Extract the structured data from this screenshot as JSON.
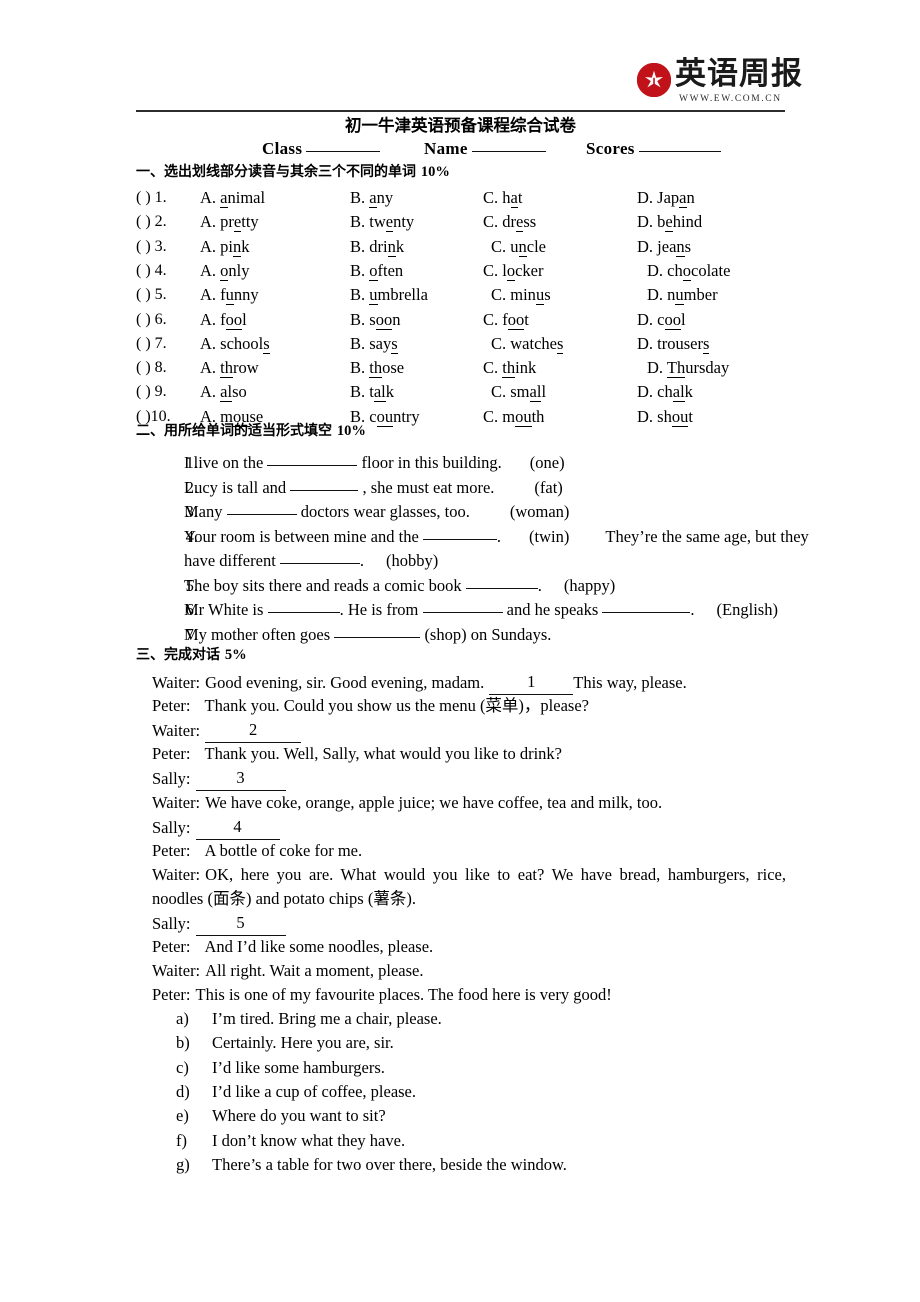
{
  "logo": {
    "name_cn": "英语周报",
    "url": "WWW.EW.COM.CN",
    "mark_color": "#c1121a"
  },
  "header": {
    "title": "初一牛津英语预备课程综合试卷",
    "fields": [
      {
        "label": "Class",
        "value": ""
      },
      {
        "label": "Name",
        "value": ""
      },
      {
        "label": "Scores",
        "value": ""
      }
    ]
  },
  "section1": {
    "heading": "一、选出划线部分读音与其余三个不同的单词",
    "points": "10%",
    "rows": [
      {
        "num": "(  ) 1.",
        "a": [
          "",
          "a",
          "nimal"
        ],
        "b": [
          "",
          "a",
          "ny"
        ],
        "c": [
          "h",
          "a",
          "t"
        ],
        "d": [
          "Jap",
          "a",
          "n"
        ]
      },
      {
        "num": "(  ) 2.",
        "a": [
          "pr",
          "e",
          "tty"
        ],
        "b": [
          "tw",
          "e",
          "nty"
        ],
        "c": [
          "dr",
          "e",
          "ss"
        ],
        "d": [
          "b",
          "e",
          "hind"
        ]
      },
      {
        "num": "(  ) 3.",
        "a": [
          "pi",
          "n",
          "k"
        ],
        "b": [
          "dri",
          "n",
          "k"
        ],
        "c": [
          "u",
          "n",
          "cle"
        ],
        "d": [
          "jea",
          "n",
          "s"
        ]
      },
      {
        "num": "(  ) 4.",
        "a": [
          "",
          "o",
          "nly"
        ],
        "b": [
          "",
          "o",
          "ften"
        ],
        "c": [
          "l",
          "o",
          "cker"
        ],
        "d": [
          "ch",
          "o",
          "colate"
        ]
      },
      {
        "num": "(  ) 5.",
        "a": [
          "f",
          "u",
          "nny"
        ],
        "b": [
          "",
          "u",
          "mbrella"
        ],
        "c": [
          "min",
          "u",
          "s"
        ],
        "d": [
          "n",
          "u",
          "mber"
        ]
      },
      {
        "num": "(  ) 6.",
        "a": [
          "f",
          "oo",
          "l"
        ],
        "b": [
          "s",
          "oo",
          "n"
        ],
        "c": [
          "f",
          "oo",
          "t"
        ],
        "d": [
          "c",
          "oo",
          "l"
        ]
      },
      {
        "num": "(  ) 7.",
        "a": [
          "school",
          "s",
          ""
        ],
        "b": [
          "say",
          "s",
          ""
        ],
        "c": [
          "watche",
          "s",
          ""
        ],
        "d": [
          "trouser",
          "s",
          ""
        ]
      },
      {
        "num": "(  ) 8.",
        "a": [
          "",
          "th",
          "row"
        ],
        "b": [
          "",
          "th",
          "ose"
        ],
        "c": [
          "",
          "th",
          "ink"
        ],
        "d": [
          "",
          "Th",
          "ursday"
        ]
      },
      {
        "num": "(  ) 9.",
        "a": [
          "",
          "al",
          "so"
        ],
        "b": [
          "t",
          "al",
          "k"
        ],
        "c": [
          "sm",
          "al",
          "l"
        ],
        "d": [
          "ch",
          "al",
          "k"
        ]
      },
      {
        "num": "(  )10.",
        "a": [
          "m",
          "ou",
          "se"
        ],
        "b": [
          "c",
          "ou",
          "ntry"
        ],
        "c": [
          "m",
          "ou",
          "th"
        ],
        "d": [
          "sh",
          "ou",
          "t"
        ]
      }
    ]
  },
  "section2": {
    "heading": "二、用所给单词的适当形式填空",
    "points": "10%",
    "items": [
      {
        "num": "1.",
        "parts": [
          "I live on the ",
          "_blank90_",
          " floor in this building.",
          "_gap28_",
          "(one)"
        ]
      },
      {
        "num": "2.",
        "parts": [
          "Lucy is tall and ",
          "_blank68_",
          " , she must eat more.",
          "_gap40_",
          "(fat)"
        ]
      },
      {
        "num": "3.",
        "parts": [
          "Many ",
          "_blank70_",
          " doctors wear glasses, too.",
          "_gap40_",
          "(woman)"
        ]
      },
      {
        "num": "4.",
        "parts": [
          "Your room is between mine and the ",
          "_blank74_",
          ".",
          "_gap28_",
          "(twin)",
          "_gap36_",
          "They’re the same age, but they"
        ]
      },
      {
        "num": "",
        "parts": [
          "have different ",
          "_blank80_",
          ".",
          "_gap22_",
          "(hobby)"
        ]
      },
      {
        "num": "5.",
        "parts": [
          "The boy sits there and reads a comic book ",
          "_blank72_",
          ".",
          "_gap22_",
          "(happy)"
        ]
      },
      {
        "num": "6.",
        "parts": [
          "Mr White is ",
          "_blank72_",
          ". He is from ",
          "_blank80_",
          " and he speaks ",
          "_blank88_",
          ".",
          "_gap22_",
          "(English)"
        ]
      },
      {
        "num": "7.",
        "parts": [
          "My mother often goes ",
          "_blank86_",
          " (shop) on Sundays."
        ]
      }
    ]
  },
  "section3": {
    "heading": "三、完成对话",
    "points": "5%",
    "lines": [
      {
        "speaker": "Waiter:",
        "text": "Good evening, sir. Good evening, madam.",
        "blank": "1",
        "tail": "This way, please.",
        "justify": false
      },
      {
        "speaker": "Peter:",
        "text": "Thank you. Could you show us the menu (菜单)，please?",
        "indent": true,
        "justify": false
      },
      {
        "speaker": "Waiter:",
        "text": "",
        "blank": "2",
        "blankwidth": 96,
        "justify": false
      },
      {
        "speaker": "Peter:",
        "text": "Thank you. Well, Sally, what would you like to drink?",
        "indent": true,
        "justify": false
      },
      {
        "speaker": "Sally:",
        "text": "",
        "blank": "3",
        "blankwidth": 90,
        "justify": false
      },
      {
        "speaker": "Waiter:",
        "text": "We have coke, orange, apple juice; we have coffee, tea and milk, too.",
        "justify": false
      },
      {
        "speaker": "Sally:",
        "text": "",
        "blank": "4",
        "blankwidth": 84,
        "justify": false
      },
      {
        "speaker": "Peter:",
        "text": "A bottle of coke for me.",
        "indent": true,
        "justify": false
      },
      {
        "speaker": "Waiter:",
        "text": "OK, here you are. What would you like to eat? We have bread, hamburgers, rice,",
        "justify": true
      },
      {
        "speaker": "",
        "text": "noodles (面条) and potato chips (薯条).",
        "justify": false
      },
      {
        "speaker": "Sally:",
        "text": "",
        "blank": "5",
        "blankwidth": 90,
        "justify": false
      },
      {
        "speaker": "Peter:",
        "text": "And I’d like some noodles, please.",
        "indent": true,
        "justify": false
      },
      {
        "speaker": "Waiter:",
        "text": "All right. Wait a moment, please.",
        "justify": false
      },
      {
        "speaker": "Peter:",
        "text": "This is one of my favourite places. The food here is very good!",
        "justify": false
      }
    ],
    "options": [
      {
        "key": "a)",
        "text": "I’m tired. Bring me a chair, please."
      },
      {
        "key": "b)",
        "text": "Certainly. Here you are, sir."
      },
      {
        "key": "c)",
        "text": "I’d like some hamburgers."
      },
      {
        "key": "d)",
        "text": "I’d like a cup of coffee, please."
      },
      {
        "key": "e)",
        "text": "Where do you want to sit?"
      },
      {
        "key": "f)",
        "text": "I don’t know what they have."
      },
      {
        "key": "g)",
        "text": "There’s a table for two over there, beside the window."
      }
    ]
  }
}
